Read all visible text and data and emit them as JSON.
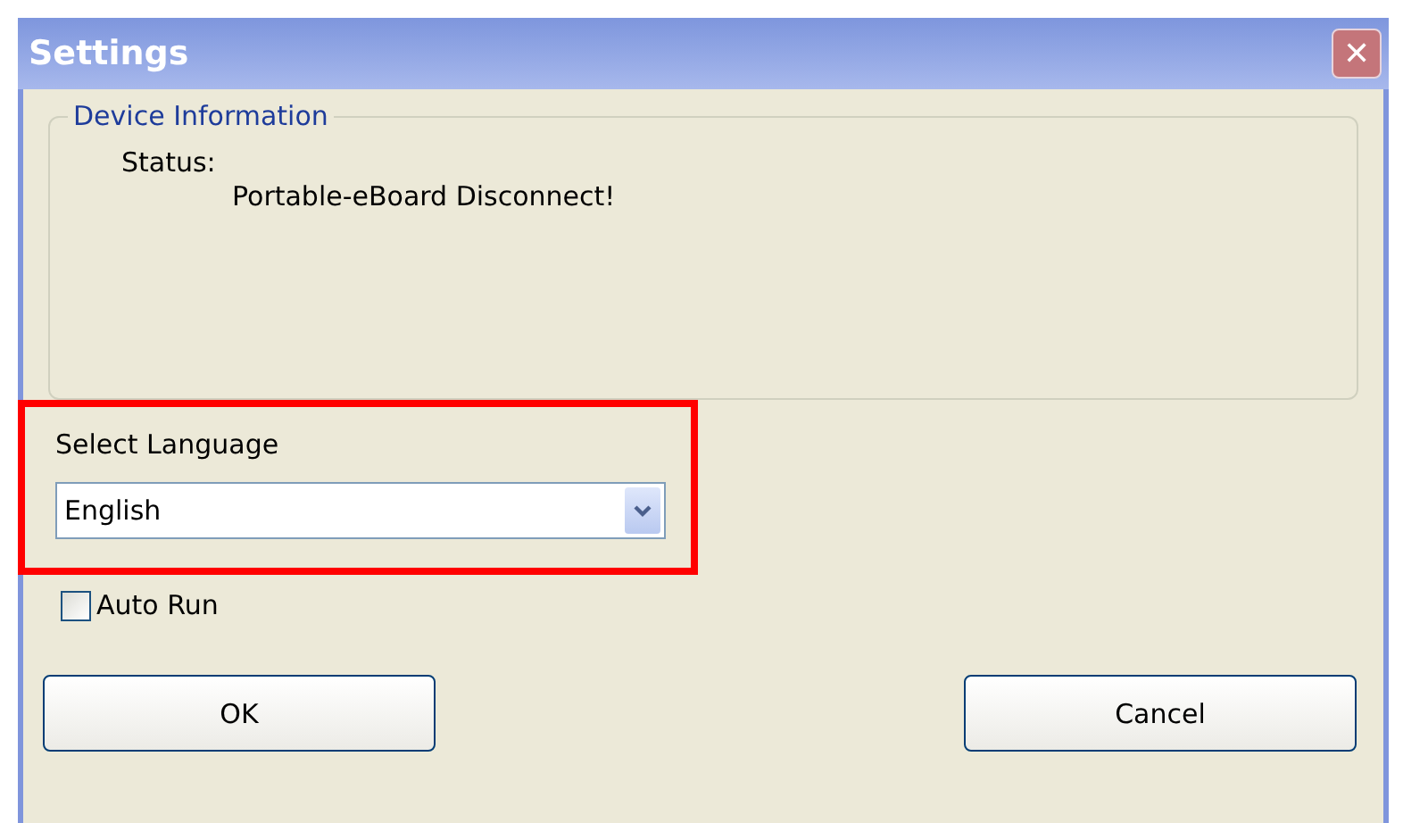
{
  "window": {
    "title": "Settings",
    "close": "✕"
  },
  "device_information": {
    "legend": "Device Information",
    "status_label": "Status:",
    "status_value": "Portable-eBoard Disconnect!"
  },
  "language": {
    "label": "Select Language",
    "value": "English",
    "highlighted": true
  },
  "auto_run": {
    "label": "Auto Run",
    "checked": false
  },
  "buttons": [
    {
      "label": "OK"
    },
    {
      "label": "Cancel"
    }
  ]
}
